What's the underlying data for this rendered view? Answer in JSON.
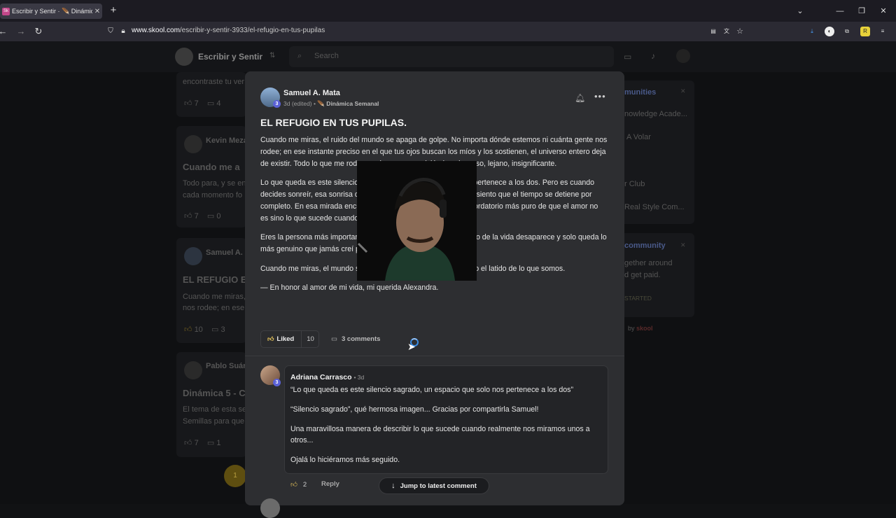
{
  "browser": {
    "tab_title": "Escribir y Sentir · 🪶 Dinámica Semanal",
    "tab_favicon": "Sk",
    "url_host": "www.skool.com",
    "url_path": "/escribir-y-sentir-3933/el-refugio-en-tus-pupilas"
  },
  "site": {
    "name": "Escribir y Sentir",
    "search_placeholder": "Search"
  },
  "background": {
    "cards": [
      {
        "text_top": "encontraste tu ver",
        "likes": "7",
        "comments": "4"
      },
      {
        "author": "Kevin Meza",
        "title": "Cuando me a",
        "text1": "Todo para, y se en",
        "text2": "cada momento fo",
        "likes": "7",
        "comments": "0"
      },
      {
        "author": "Samuel A. M",
        "title": "EL REFUGIO EN",
        "text1": "Cuando me miras,",
        "text2": "nos rodee; en ese",
        "likes": "10",
        "comments": "3"
      },
      {
        "author": "Pablo Suár",
        "title": "Dinámica 5 - C",
        "text1": "El tema de esta se",
        "text2": "Semillas para que",
        "likes": "7",
        "comments": "1"
      }
    ],
    "page_num": "1",
    "right": {
      "communities_title": "munities",
      "items": [
        "nowledge Acade...",
        "A Volar",
        "r Club",
        "Real Style Com..."
      ],
      "community_title": "community",
      "community_text1": "gether around",
      "community_text2": "d get paid.",
      "cta": "STARTED",
      "powered": "by",
      "brand": "skool"
    }
  },
  "post": {
    "author": "Samuel A. Mata",
    "author_level": "3",
    "meta_time": "3d (edited) •",
    "category": "🪶 Dinámica Semanal",
    "title": "EL REFUGIO EN TUS PUPILAS.",
    "paragraphs": [
      "Cuando me miras, el ruido del mundo se apaga de golpe. No importa dónde estemos ni cuánta gente nos rodee; en ese instante preciso en el que tus ojos buscan los míos y los sostienen, el universo entero deja de existir. Todo lo que me rodea se desvanece, volviéndose borroso, lejano, insignificante.",
      "Lo que queda es este silencio sagrado, un espacio que solo nos pertenece a los dos. Pero es cuando decides sonreír, esa sonrisa que consigue aclararlo todo, cuando siento que el tiempo se detiene por completo. En esa mirada encuentro mi paz y mi refugio; es el recordatorio más puro de que el amor no es sino lo que sucede cuando estoy frente a ti.",
      "Eres la persona más importante. En ese cruce de miradas, el resto de la vida desaparece y solo queda lo más genuino que jamás creí poder sentir.",
      "Cuando me miras, el mundo se queda sin volumen y solo escucho el latido de lo que somos.",
      "— En honor al amor de mi vida, mi querida Alexandra."
    ],
    "liked_label": "Liked",
    "like_count": "10",
    "comments_label": "3 comments"
  },
  "comment": {
    "author": "Adriana Carrasco",
    "author_level": "3",
    "time": "• 3d",
    "paragraphs": [
      "“Lo que queda es este silencio sagrado, un espacio que solo nos pertenece a los dos”",
      "“Silencio sagrado”, qué hermosa imagen... Gracias por compartirla Samuel!",
      "Una maravillosa manera de describir lo que sucede cuando realmente nos miramos unos a otros...",
      "Ojalá lo hiciéramos más seguido."
    ],
    "like_count": "2",
    "reply_label": "Reply"
  },
  "jump_label": "Jump to latest comment",
  "colors": {
    "accent_liked": "#e6c45a",
    "level_badge": "#5b61d6",
    "spinner": "#3b8be0"
  }
}
